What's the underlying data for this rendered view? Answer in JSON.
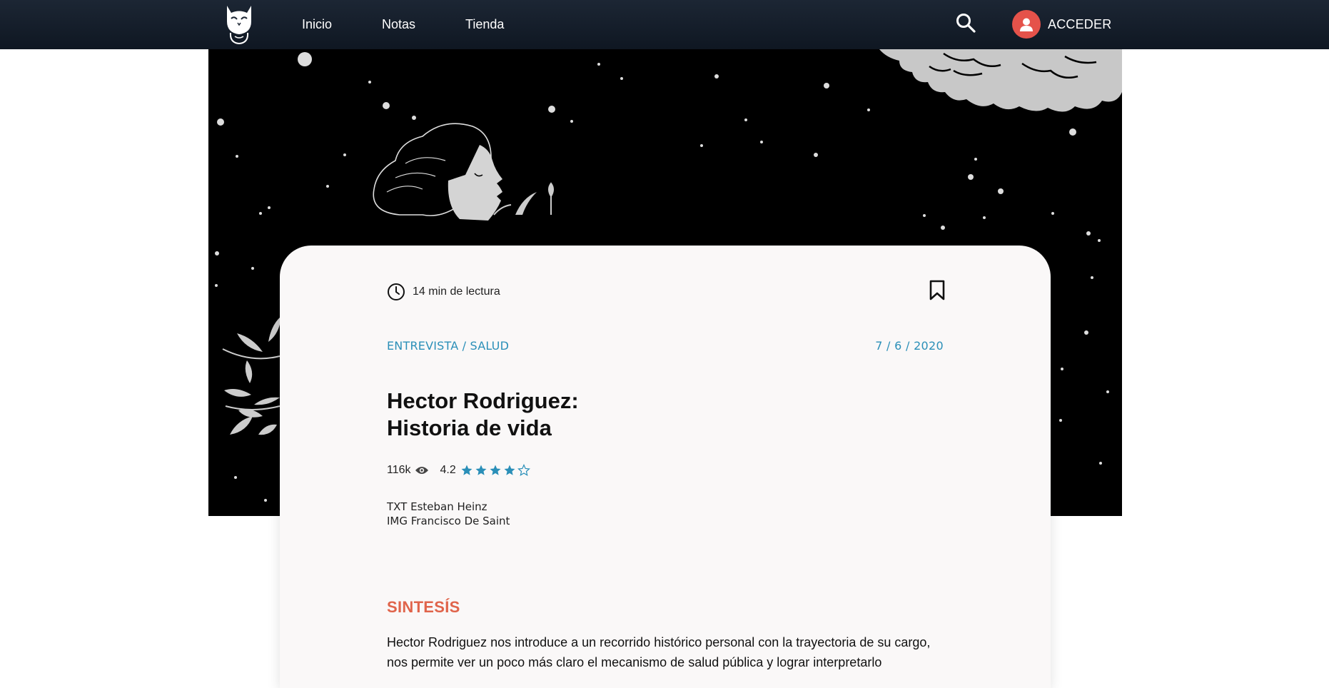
{
  "nav": {
    "links": [
      {
        "label": "Inicio"
      },
      {
        "label": "Notas"
      },
      {
        "label": "Tienda"
      }
    ],
    "login_label": "ACCEDER",
    "accent_color": "#e5524a"
  },
  "article": {
    "read_time": "14 min de lectura",
    "category": "ENTREVISTA / SALUD",
    "date": "7 / 6 / 2020",
    "title_line1": "Hector Rodriguez:",
    "title_line2": "Historia de vida",
    "views": "116k",
    "rating": "4.2",
    "rating_value": 4.2,
    "rating_max": 5,
    "credit_text": "TXT Esteban Heinz",
    "credit_image": "IMG Francisco De Saint",
    "section_title": "SINTESÍS",
    "summary": "Hector Rodriguez nos introduce a un recorrido histórico personal con la trayectoria de su cargo, nos permite ver un poco más claro el mecanismo de salud pública y lograr interpretarlo",
    "link_color": "#2a8fb8",
    "section_color": "#e0644b"
  },
  "icons": {
    "logo": "owl-logo-icon",
    "search": "search-icon",
    "user": "user-icon",
    "clock": "clock-icon",
    "bookmark": "bookmark-icon",
    "eye": "eye-icon",
    "star": "star-icon"
  }
}
